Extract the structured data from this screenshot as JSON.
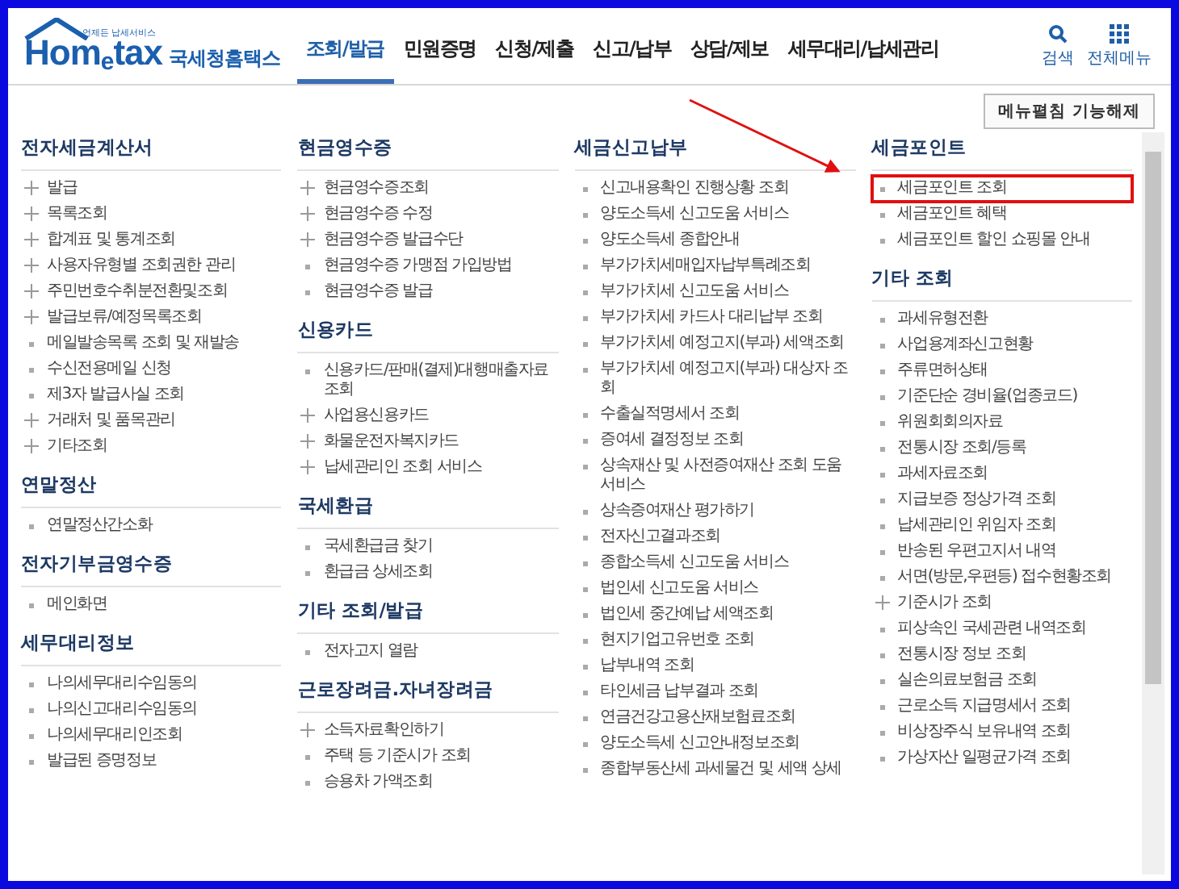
{
  "header": {
    "logo": {
      "tagline": "언제든 납세서비스",
      "wordmark": "Hom$_{e}$tax",
      "name": "국세청홈택스"
    },
    "nav": [
      {
        "label": "조회/발급",
        "selected": true
      },
      {
        "label": "민원증명",
        "selected": false
      },
      {
        "label": "신청/제출",
        "selected": false
      },
      {
        "label": "신고/납부",
        "selected": false
      },
      {
        "label": "상담/제보",
        "selected": false
      },
      {
        "label": "세무대리/납세관리",
        "selected": false
      }
    ],
    "actions": [
      {
        "kind": "search",
        "label": "검색"
      },
      {
        "kind": "menu",
        "label": "전체메뉴"
      }
    ]
  },
  "toolbar": {
    "button": "메뉴펼침 기능해제"
  },
  "columns": [
    {
      "sections": [
        {
          "title": "전자세금계산서",
          "items": [
            {
              "label": "발급",
              "kind": "expand",
              "highlighted": false
            },
            {
              "label": "목록조회",
              "kind": "expand",
              "highlighted": false
            },
            {
              "label": "합계표 및 통계조회",
              "kind": "expand",
              "highlighted": false
            },
            {
              "label": "사용자유형별 조회권한 관리",
              "kind": "expand",
              "highlighted": false
            },
            {
              "label": "주민번호수취분전환및조회",
              "kind": "expand",
              "highlighted": false
            },
            {
              "label": "발급보류/예정목록조회",
              "kind": "expand",
              "highlighted": false
            },
            {
              "label": "메일발송목록 조회 및 재발송",
              "kind": "link",
              "highlighted": false
            },
            {
              "label": "수신전용메일 신청",
              "kind": "link",
              "highlighted": false
            },
            {
              "label": "제3자 발급사실 조회",
              "kind": "link",
              "highlighted": false
            },
            {
              "label": "거래처 및 품목관리",
              "kind": "expand",
              "highlighted": false
            },
            {
              "label": "기타조회",
              "kind": "expand",
              "highlighted": false
            }
          ]
        },
        {
          "title": "연말정산",
          "items": [
            {
              "label": "연말정산간소화",
              "kind": "link",
              "highlighted": false
            }
          ]
        },
        {
          "title": "전자기부금영수증",
          "items": [
            {
              "label": "메인화면",
              "kind": "link",
              "highlighted": false
            }
          ]
        },
        {
          "title": "세무대리정보",
          "items": [
            {
              "label": "나의세무대리수임동의",
              "kind": "link",
              "highlighted": false
            },
            {
              "label": "나의신고대리수임동의",
              "kind": "link",
              "highlighted": false
            },
            {
              "label": "나의세무대리인조회",
              "kind": "link",
              "highlighted": false
            },
            {
              "label": "발급된 증명정보",
              "kind": "link",
              "highlighted": false
            }
          ]
        }
      ]
    },
    {
      "sections": [
        {
          "title": "현금영수증",
          "items": [
            {
              "label": "현금영수증조회",
              "kind": "expand",
              "highlighted": false
            },
            {
              "label": "현금영수증 수정",
              "kind": "expand",
              "highlighted": false
            },
            {
              "label": "현금영수증 발급수단",
              "kind": "expand",
              "highlighted": false
            },
            {
              "label": "현금영수증 가맹점 가입방법",
              "kind": "link",
              "highlighted": false
            },
            {
              "label": "현금영수증 발급",
              "kind": "link",
              "highlighted": false
            }
          ]
        },
        {
          "title": "신용카드",
          "items": [
            {
              "label": "신용카드/판매(결제)대행매출자료조회",
              "kind": "link",
              "highlighted": false
            },
            {
              "label": "사업용신용카드",
              "kind": "expand",
              "highlighted": false
            },
            {
              "label": "화물운전자복지카드",
              "kind": "expand",
              "highlighted": false
            },
            {
              "label": "납세관리인 조회 서비스",
              "kind": "expand",
              "highlighted": false
            }
          ]
        },
        {
          "title": "국세환급",
          "items": [
            {
              "label": "국세환급금 찾기",
              "kind": "link",
              "highlighted": false
            },
            {
              "label": "환급금 상세조회",
              "kind": "link",
              "highlighted": false
            }
          ]
        },
        {
          "title": "기타 조회/발급",
          "items": [
            {
              "label": "전자고지 열람",
              "kind": "link",
              "highlighted": false
            }
          ]
        },
        {
          "title": "근로장려금.자녀장려금",
          "items": [
            {
              "label": "소득자료확인하기",
              "kind": "expand",
              "highlighted": false
            },
            {
              "label": "주택 등 기준시가 조회",
              "kind": "link",
              "highlighted": false
            },
            {
              "label": "승용차 가액조회",
              "kind": "link",
              "highlighted": false
            }
          ]
        }
      ]
    },
    {
      "sections": [
        {
          "title": "세금신고납부",
          "items": [
            {
              "label": "신고내용확인 진행상황 조회",
              "kind": "link",
              "highlighted": false
            },
            {
              "label": "양도소득세 신고도움 서비스",
              "kind": "link",
              "highlighted": false
            },
            {
              "label": "양도소득세 종합안내",
              "kind": "link",
              "highlighted": false
            },
            {
              "label": "부가가치세매입자납부특례조회",
              "kind": "link",
              "highlighted": false
            },
            {
              "label": "부가가치세 신고도움 서비스",
              "kind": "link",
              "highlighted": false
            },
            {
              "label": "부가가치세 카드사 대리납부 조회",
              "kind": "link",
              "highlighted": false
            },
            {
              "label": "부가가치세 예정고지(부과) 세액조회",
              "kind": "link",
              "highlighted": false
            },
            {
              "label": "부가가치세 예정고지(부과) 대상자 조회",
              "kind": "link",
              "highlighted": false
            },
            {
              "label": "수출실적명세서 조회",
              "kind": "link",
              "highlighted": false
            },
            {
              "label": "증여세 결정정보 조회",
              "kind": "link",
              "highlighted": false
            },
            {
              "label": "상속재산 및 사전증여재산 조회 도움 서비스",
              "kind": "link",
              "highlighted": false
            },
            {
              "label": "상속증여재산 평가하기",
              "kind": "link",
              "highlighted": false
            },
            {
              "label": "전자신고결과조회",
              "kind": "link",
              "highlighted": false
            },
            {
              "label": "종합소득세 신고도움 서비스",
              "kind": "link",
              "highlighted": false
            },
            {
              "label": "법인세 신고도움 서비스",
              "kind": "link",
              "highlighted": false
            },
            {
              "label": "법인세 중간예납 세액조회",
              "kind": "link",
              "highlighted": false
            },
            {
              "label": "현지기업고유번호 조회",
              "kind": "link",
              "highlighted": false
            },
            {
              "label": "납부내역 조회",
              "kind": "link",
              "highlighted": false
            },
            {
              "label": "타인세금 납부결과 조회",
              "kind": "link",
              "highlighted": false
            },
            {
              "label": "연금건강고용산재보험료조회",
              "kind": "link",
              "highlighted": false
            },
            {
              "label": "양도소득세 신고안내정보조회",
              "kind": "link",
              "highlighted": false
            },
            {
              "label": "종합부동산세 과세물건 및 세액 상세",
              "kind": "link",
              "highlighted": false
            }
          ]
        }
      ]
    },
    {
      "sections": [
        {
          "title": "세금포인트",
          "items": [
            {
              "label": "세금포인트 조회",
              "kind": "link",
              "highlighted": true
            },
            {
              "label": "세금포인트 혜택",
              "kind": "link",
              "highlighted": false
            },
            {
              "label": "세금포인트 할인 쇼핑몰 안내",
              "kind": "link",
              "highlighted": false
            }
          ]
        },
        {
          "title": "기타 조회",
          "items": [
            {
              "label": "과세유형전환",
              "kind": "link",
              "highlighted": false
            },
            {
              "label": "사업용계좌신고현황",
              "kind": "link",
              "highlighted": false
            },
            {
              "label": "주류면허상태",
              "kind": "link",
              "highlighted": false
            },
            {
              "label": "기준단순 경비율(업종코드)",
              "kind": "link",
              "highlighted": false
            },
            {
              "label": "위원회회의자료",
              "kind": "link",
              "highlighted": false
            },
            {
              "label": "전통시장 조회/등록",
              "kind": "link",
              "highlighted": false
            },
            {
              "label": "과세자료조회",
              "kind": "link",
              "highlighted": false
            },
            {
              "label": "지급보증 정상가격 조회",
              "kind": "link",
              "highlighted": false
            },
            {
              "label": "납세관리인 위임자 조회",
              "kind": "link",
              "highlighted": false
            },
            {
              "label": "반송된 우편고지서 내역",
              "kind": "link",
              "highlighted": false
            },
            {
              "label": "서면(방문,우편등) 접수현황조회",
              "kind": "link",
              "highlighted": false
            },
            {
              "label": "기준시가 조회",
              "kind": "expand",
              "highlighted": false
            },
            {
              "label": "피상속인 국세관련 내역조회",
              "kind": "link",
              "highlighted": false
            },
            {
              "label": "전통시장 정보 조회",
              "kind": "link",
              "highlighted": false
            },
            {
              "label": "실손의료보험금 조회",
              "kind": "link",
              "highlighted": false
            },
            {
              "label": "근로소득 지급명세서 조회",
              "kind": "link",
              "highlighted": false
            },
            {
              "label": "비상장주식 보유내역 조회",
              "kind": "link",
              "highlighted": false
            },
            {
              "label": "가상자산 일평균가격 조회",
              "kind": "link",
              "highlighted": false
            }
          ]
        }
      ]
    }
  ]
}
